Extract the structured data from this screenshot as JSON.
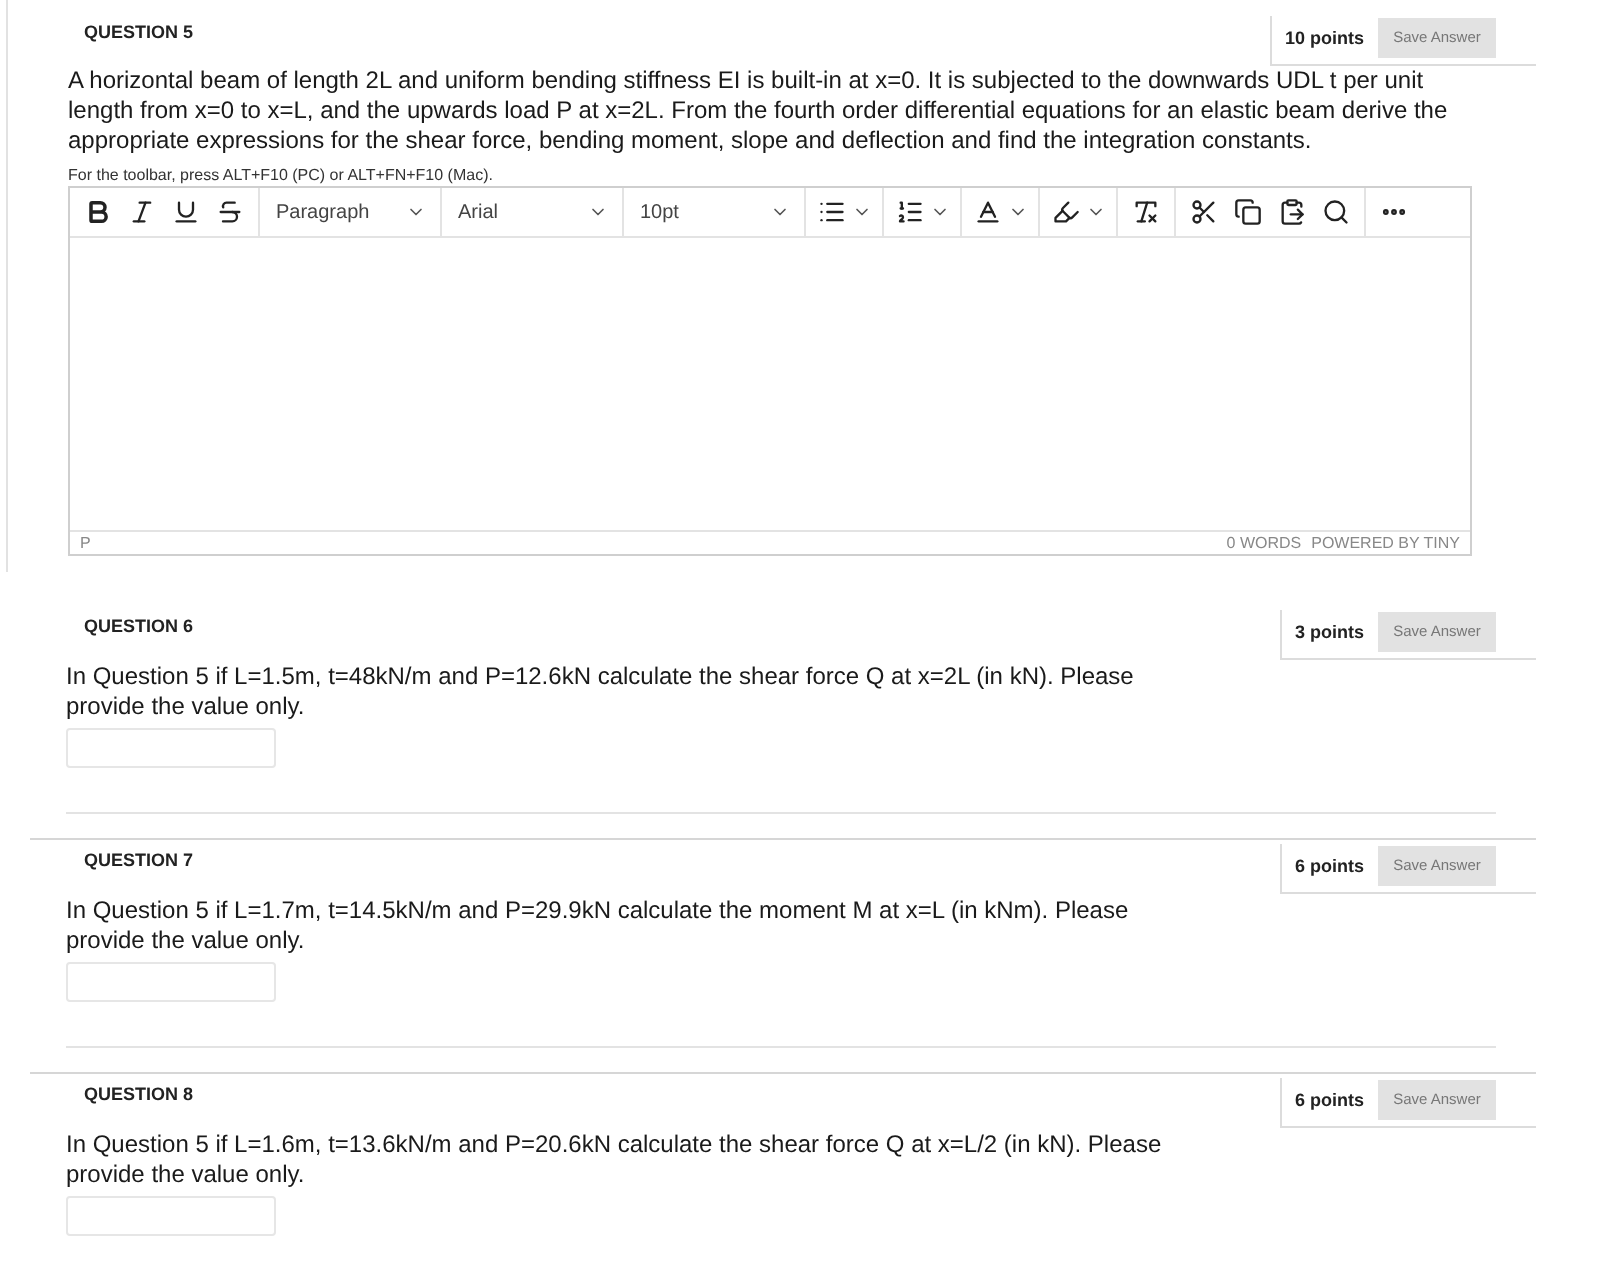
{
  "questions": [
    {
      "kind": "essay",
      "title": "QUESTION 5",
      "points": "10 points",
      "save_button": "Save Answer",
      "text": "A horizontal beam of length 2L and uniform bending stiffness EI is built-in at x=0. It is subjected to the downwards UDL t per unit length from x=0 to x=L, and the upwards load P at x=2L. From the fourth order differential equations for an elastic beam derive the appropriate expressions for the shear force, bending moment, slope and deflection and find the integration constants.",
      "toolbar_hint": "For the toolbar, press ALT+F10 (PC) or ALT+FN+F10 (Mac).",
      "editor": {
        "block_format": "Paragraph",
        "font_family": "Arial",
        "font_size": "10pt",
        "path": "P",
        "word_count": "0 WORDS",
        "branding": "POWERED BY TINY"
      }
    },
    {
      "kind": "short_answer",
      "title": "QUESTION 6",
      "points": "3 points",
      "save_button": "Save Answer",
      "text": "In Question 5 if L=1.5m, t=48kN/m and P=12.6kN calculate the shear force Q at x=2L (in kN). Please provide the value only."
    },
    {
      "kind": "short_answer",
      "title": "QUESTION 7",
      "points": "6 points",
      "save_button": "Save Answer",
      "text": "In Question 5 if L=1.7m, t=14.5kN/m and P=29.9kN calculate the moment M at x=L (in kNm). Please provide the value only."
    },
    {
      "kind": "short_answer",
      "title": "QUESTION 8",
      "points": "6 points",
      "save_button": "Save Answer",
      "text": "In Question 5 if L=1.6m, t=13.6kN/m and P=20.6kN calculate the shear force Q at x=L/2 (in kN). Please provide the value only."
    }
  ]
}
